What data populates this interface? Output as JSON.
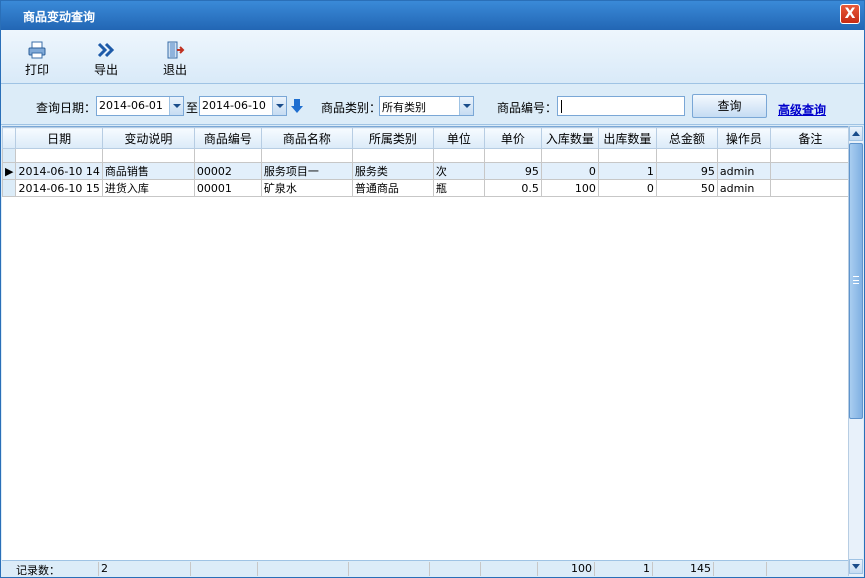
{
  "window": {
    "title": "商品变动查询",
    "close_label": "X"
  },
  "toolbar": {
    "print_label": "打印",
    "export_label": "导出",
    "exit_label": "退出"
  },
  "filter": {
    "date_label": "查询日期：",
    "date_from": "2014-06-01",
    "to_label": "至",
    "date_to": "2014-06-10",
    "category_label": "商品类别：",
    "category_value": "所有类别",
    "code_label": "商品编号：",
    "code_value": "",
    "query_label": "查询",
    "advanced_label": "高级查询"
  },
  "grid": {
    "columns": [
      "日期",
      "变动说明",
      "商品编号",
      "商品名称",
      "所属类别",
      "单位",
      "单价",
      "入库数量",
      "出库数量",
      "总金额",
      "操作员",
      "备注"
    ],
    "rows": [
      {
        "date": "2014-06-10 14",
        "desc": "商品销售",
        "code": "00002",
        "name": "服务项目一",
        "category": "服务类",
        "unit": "次",
        "price": "95",
        "in_qty": "0",
        "out_qty": "1",
        "total": "95",
        "operator": "admin",
        "note": ""
      },
      {
        "date": "2014-06-10 15",
        "desc": "进货入库",
        "code": "00001",
        "name": "矿泉水",
        "category": "普通商品",
        "unit": "瓶",
        "price": "0.5",
        "in_qty": "100",
        "out_qty": "0",
        "total": "50",
        "operator": "admin",
        "note": ""
      }
    ]
  },
  "footer": {
    "count_label": "记录数：",
    "count_value": "2",
    "in_total": "100",
    "out_total": "1",
    "amount_total": "145"
  },
  "colors": {
    "title_bar": "#2a74c4",
    "panel": "#dcecf8",
    "link": "#0000cc",
    "close": "#d63a1e"
  }
}
